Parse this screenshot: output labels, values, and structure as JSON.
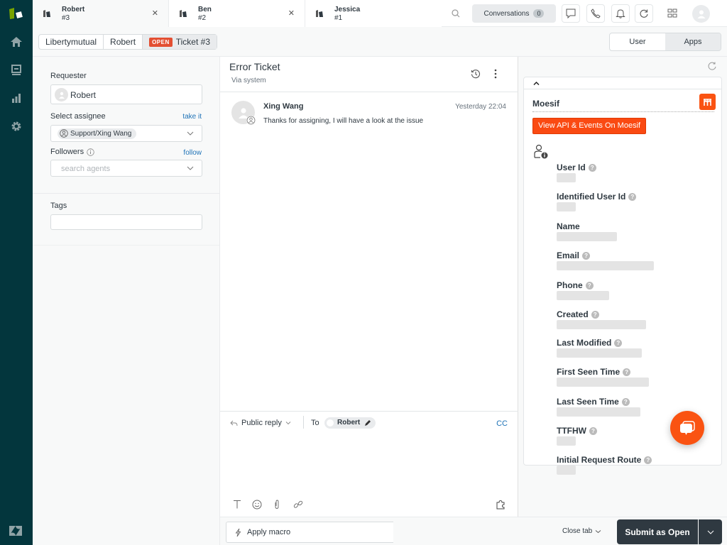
{
  "tabs": [
    {
      "name": "Robert",
      "number": "#3",
      "active": true
    },
    {
      "name": "Ben",
      "number": "#2",
      "active": false
    },
    {
      "name": "Jessica",
      "number": "#1",
      "active": false
    }
  ],
  "topbar": {
    "conversations_label": "Conversations",
    "conversations_count": "0"
  },
  "breadcrumb": {
    "org": "Libertymutual",
    "user": "Robert",
    "status": "OPEN",
    "ticket": "Ticket #3"
  },
  "view_toggle": {
    "user": "User",
    "apps": "Apps",
    "selected": "Apps"
  },
  "properties": {
    "requester_label": "Requester",
    "requester_value": "Robert",
    "assignee_label": "Select assignee",
    "take_it": "take it",
    "assignee_value": "Support/Xing Wang",
    "followers_label": "Followers",
    "follow": "follow",
    "followers_placeholder": "search agents",
    "tags_label": "Tags"
  },
  "ticket": {
    "title": "Error Ticket",
    "via": "Via system"
  },
  "messages": [
    {
      "author": "Xing Wang",
      "time": "Yesterday 22:04",
      "body": "Thanks for assigning, I will have a look at the issue"
    }
  ],
  "composer": {
    "mode": "Public reply",
    "to_label": "To",
    "recipient": "Robert",
    "cc": "CC"
  },
  "footer": {
    "macro_placeholder": "Apply macro",
    "close_tab": "Close tab",
    "submit": "Submit as Open"
  },
  "moesif": {
    "title": "Moesif",
    "button": "View API & Events On Moesif",
    "brand_color": "#fa5312",
    "fields": [
      {
        "label": "User Id",
        "help": true
      },
      {
        "label": "Identified User Id",
        "help": true
      },
      {
        "label": "Name",
        "help": false
      },
      {
        "label": "Email",
        "help": true
      },
      {
        "label": "Phone",
        "help": true
      },
      {
        "label": "Created",
        "help": true
      },
      {
        "label": "Last Modified",
        "help": true
      },
      {
        "label": "First Seen Time",
        "help": true
      },
      {
        "label": "Last Seen Time",
        "help": true
      },
      {
        "label": "TTFHW",
        "help": true
      },
      {
        "label": "Initial Request Route",
        "help": true
      }
    ]
  }
}
